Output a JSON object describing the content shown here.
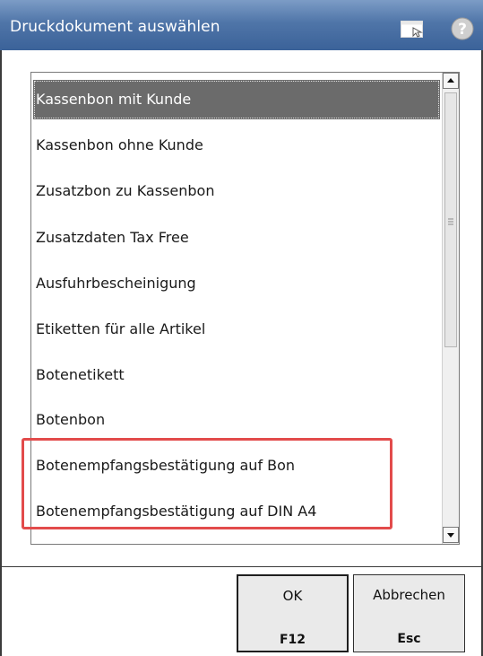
{
  "dialog": {
    "title": "Druckdokument auswählen"
  },
  "list": {
    "items": [
      {
        "label": "Kassenbon mit Kunde",
        "selected": true
      },
      {
        "label": "Kassenbon ohne Kunde"
      },
      {
        "label": "Zusatzbon zu Kassenbon"
      },
      {
        "label": "Zusatzdaten Tax Free"
      },
      {
        "label": "Ausfuhrbescheinigung"
      },
      {
        "label": "Etiketten für alle Artikel"
      },
      {
        "label": "Botenetikett"
      },
      {
        "label": "Botenbon"
      },
      {
        "label": "Botenempfangsbestätigung auf Bon"
      },
      {
        "label": "Botenempfangsbestätigung auf DIN A4"
      }
    ]
  },
  "buttons": {
    "ok": {
      "label": "OK",
      "key": "F12"
    },
    "cancel": {
      "label": "Abbrechen",
      "key": "Esc"
    }
  },
  "icons": {
    "window": "window-icon",
    "help": "help-icon"
  },
  "colors": {
    "titlebar": "#4f75a8",
    "selected_item": "#6b6b6b",
    "highlight_box": "#e24b4b"
  }
}
